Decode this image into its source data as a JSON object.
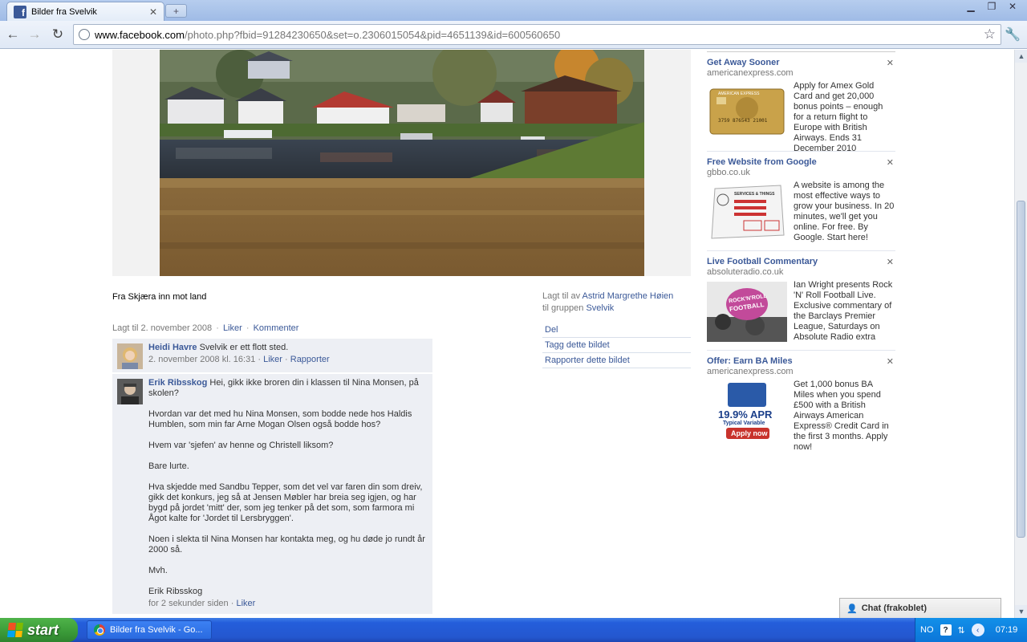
{
  "browser": {
    "tab_title": "Bilder fra Svelvik",
    "tab_close": "✕",
    "new_tab": "+",
    "url_host": "www.facebook.com",
    "url_path": "/photo.php?fbid=91284230650&set=o.2306015054&pid=4651139&id=600560650"
  },
  "photo": {
    "caption": "Fra Skjæra inn mot land"
  },
  "photo_info": {
    "added_by_prefix": "Lagt til av ",
    "added_by_name": "Astrid Margrethe Høien",
    "group_prefix": "til gruppen ",
    "group_name": "Svelvik"
  },
  "actions": [
    {
      "label": "Del"
    },
    {
      "label": "Tagg dette bildet"
    },
    {
      "label": "Rapporter dette bildet"
    }
  ],
  "meta": {
    "added": "Lagt til 2. november 2008",
    "like": "Liker",
    "comment": "Kommenter",
    "sep": "·"
  },
  "comments": [
    {
      "name": "Heidi Havre",
      "text": "Svelvik er ett flott sted.",
      "stamp": "2. november 2008 kl. 16:31",
      "like": "Liker",
      "report": "Rapporter"
    },
    {
      "name": "Erik Ribsskog",
      "text": "Hei, gikk ikke broren din i klassen til Nina Monsen, på skolen?",
      "paras": [
        "Hvordan var det med hu Nina Monsen, som bodde nede hos Haldis Humblen, som min far Arne Mogan Olsen også bodde hos?",
        "Hvem var 'sjefen' av henne og Christell liksom?",
        "Bare lurte.",
        "Hva skjedde med Sandbu Tepper, som det vel var faren din som dreiv, gikk det konkurs, jeg så at Jensen Møbler har breia seg igjen, og har bygd på jordet 'mitt' der, som jeg tenker på det som, som farmora mi Ågot kalte for 'Jordet til Lersbryggen'.",
        "Noen i slekta til Nina Monsen har kontakta meg, og hu døde jo rundt år 2000 så.",
        "Mvh.",
        "Erik Ribsskog"
      ],
      "stamp": "for 2 sekunder siden",
      "like": "Liker"
    }
  ],
  "ads": [
    {
      "title": "Get Away Sooner",
      "domain": "americanexpress.com",
      "body": "Apply for Amex Gold Card and get 20,000 bonus points – enough for a return flight to Europe with British Airways. Ends 31 December 2010",
      "card_brand": "AMERICAN EXPRESS",
      "card_number": "3759 876543 21001"
    },
    {
      "title": "Free Website from Google",
      "domain": "gbbo.co.uk",
      "body": "A website is among the most effective ways to grow your business. In 20 minutes, we'll get you online. For free. By Google. Start here!",
      "img_label": "SERVICES & THINGS"
    },
    {
      "title": "Live Football Commentary",
      "domain": "absoluteradio.co.uk",
      "body": "Ian Wright presents Rock 'N' Roll Football Live. Exclusive commentary of the Barclays Premier League, Saturdays on Absolute Radio extra",
      "img_label_1": "ROCK'N'ROLL",
      "img_label_2": "FOOTBALL"
    },
    {
      "title": "Offer: Earn BA Miles",
      "domain": "americanexpress.com",
      "body": "Get 1,000 bonus BA Miles when you spend £500 with a British Airways American Express® Credit Card in the first 3 months. Apply now!",
      "img_apr": "19.9% APR",
      "img_sub": "Typical Variable",
      "img_btn": "Apply now"
    }
  ],
  "ad_close": "✕",
  "chat": {
    "label": "Chat (frakoblet)"
  },
  "taskbar": {
    "start": "start",
    "item": "Bilder fra Svelvik - Go...",
    "lang": "NO",
    "clock": "07:19"
  },
  "colors": {
    "link": "#3b5998",
    "comment_bg": "#edeff4",
    "taskbar": "#245edb"
  }
}
